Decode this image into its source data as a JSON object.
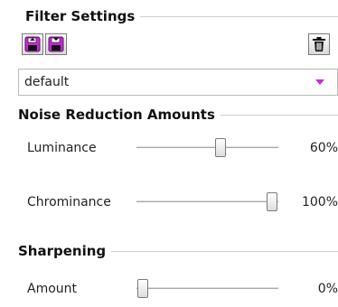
{
  "filter_settings": {
    "title": "Filter Settings",
    "load_icon": "load-preset-icon",
    "save_icon": "save-preset-icon",
    "delete_icon": "trash-icon",
    "preset": "default"
  },
  "noise_reduction": {
    "title": "Noise Reduction Amounts",
    "sliders": [
      {
        "label": "Luminance",
        "value_text": "60%",
        "fraction": 0.6
      },
      {
        "label": "Chrominance",
        "value_text": "100%",
        "fraction": 1.0
      }
    ]
  },
  "sharpening": {
    "title": "Sharpening",
    "sliders": [
      {
        "label": "Amount",
        "value_text": "0%",
        "fraction": 0.0
      }
    ]
  },
  "colors": {
    "icon_magenta": "#c02ecf",
    "dropdown_arrow": "#c02ecf"
  }
}
